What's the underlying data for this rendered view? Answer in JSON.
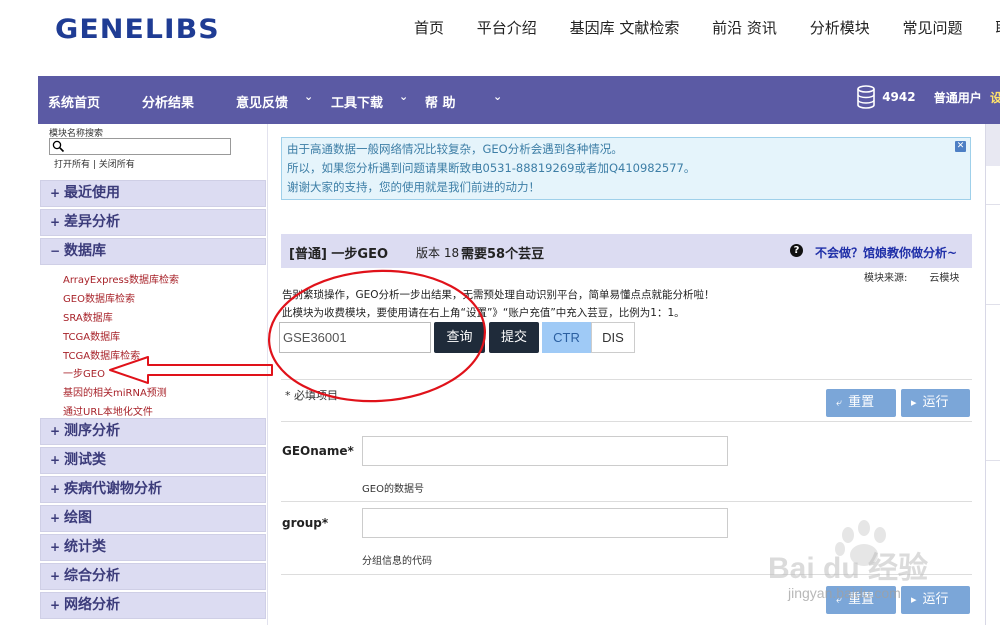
{
  "site": {
    "logo": "GENELIBS",
    "nav": [
      "首页",
      "平台介绍",
      "基因库 文献检索",
      "前沿 资讯",
      "分析模块",
      "常见问题",
      "联系"
    ]
  },
  "appbar": {
    "items": [
      "系统首页",
      "分析结果",
      "意见反馈",
      "工具下载",
      "帮 助"
    ],
    "coins": "4942",
    "role": "普通用户",
    "settings": "设置"
  },
  "sidebar": {
    "search_label": "模块名称搜索",
    "search_value": "",
    "open_all": "打开所有",
    "close_all": "关闭所有",
    "categories": [
      {
        "label": "最近使用",
        "sign": "+"
      },
      {
        "label": "差异分析",
        "sign": "+"
      },
      {
        "label": "数据库",
        "sign": "−"
      },
      {
        "label": "测序分析",
        "sign": "+"
      },
      {
        "label": "测试类",
        "sign": "+"
      },
      {
        "label": "疾病代谢物分析",
        "sign": "+"
      },
      {
        "label": "绘图",
        "sign": "+"
      },
      {
        "label": "统计类",
        "sign": "+"
      },
      {
        "label": "综合分析",
        "sign": "+"
      },
      {
        "label": "网络分析",
        "sign": "+"
      }
    ],
    "database_items": [
      "ArrayExpress数据库检索",
      "GEO数据库检索",
      "SRA数据库",
      "TCGA数据库",
      "TCGA数据库检索",
      "一步GEO",
      "基因的相关miRNA预测",
      "通过URL本地化文件"
    ]
  },
  "notice": {
    "line1": "由于高通数据一般网络情况比较复杂，GEO分析会遇到各种情况。",
    "line2": "所以，如果您分析遇到问题请果断致电0531-88819269或者加Q410982577。",
    "line3": "谢谢大家的支持，您的使用就是我们前进的动力！"
  },
  "module": {
    "name": "[普通] 一步GEO",
    "version": "版本 18",
    "cost": "需要58个芸豆",
    "help_link": "不会做？馆娘教你做分析~",
    "source_label": "模块来源:",
    "source_value": "云模块",
    "desc1": "告别繁琐操作，GEO分析一步出结果，无需预处理自动识别平台，简单易懂点点就能分析啦！",
    "desc2": "此模块为收费模块，要使用请在右上角“设置”》“账户充值”中充入芸豆，比例为1：1。",
    "query_input": "GSE36001",
    "query_btn": "查询",
    "submit_btn": "提交",
    "ctr": "CTR",
    "dis": "DIS"
  },
  "form": {
    "required_note": "* 必填项目",
    "reset": "重置",
    "run": "运行",
    "fields": [
      {
        "label": "GEOname*",
        "value": "",
        "hint": "GEO的数据号"
      },
      {
        "label": "group*",
        "value": "",
        "hint": "分组信息的代码"
      }
    ]
  },
  "watermark": {
    "text": "Bai du 经验",
    "url": "jingyan.baidu.com"
  },
  "colors": {
    "appbar": "#5b5aa4",
    "category_bg": "#dcdcf2",
    "link_red": "#a8232a",
    "annotation_red": "#e0121a",
    "blue_button": "#7ba6d8"
  }
}
